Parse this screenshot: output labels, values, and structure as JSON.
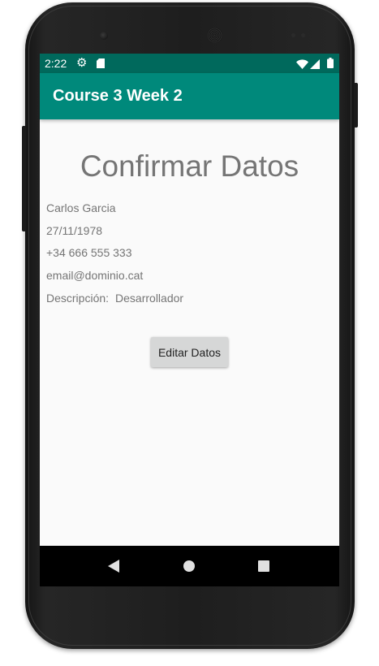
{
  "status_bar": {
    "time": "2:22",
    "icons": [
      "gear-icon",
      "sd-card-icon",
      "wifi-icon",
      "signal-icon",
      "battery-icon"
    ]
  },
  "app_bar": {
    "title": "Course 3 Week 2",
    "color": "#00897b",
    "status_color": "#00695c"
  },
  "content": {
    "heading": "Confirmar Datos",
    "name": "Carlos Garcia",
    "birth_date": "27/11/1978",
    "phone": "+34 666 555 333",
    "email": "email@dominio.cat",
    "description_label": "Descripción:",
    "description_value": "Desarrollador",
    "edit_button": "Editar Datos"
  },
  "nav_bar": {
    "icons": [
      "back-icon",
      "home-icon",
      "recents-icon"
    ]
  }
}
